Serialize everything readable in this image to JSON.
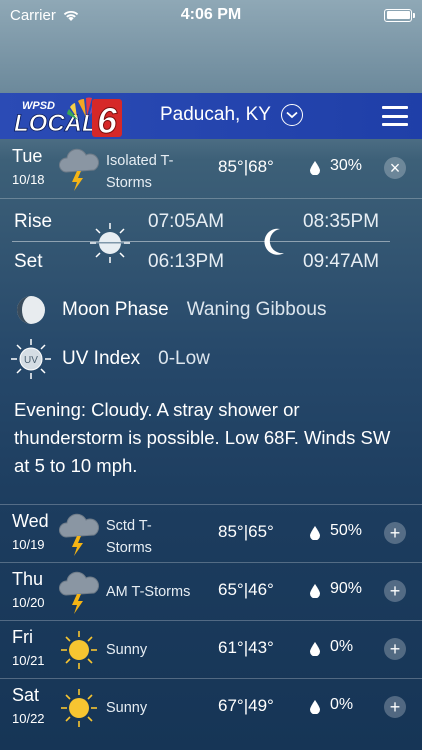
{
  "status_bar": {
    "carrier": "Carrier",
    "time": "4:06 PM"
  },
  "header": {
    "logo_top": "WPSD",
    "logo_main": "LOCAL",
    "logo_number": "6",
    "location": "Paducah, KY"
  },
  "today": {
    "day": "Tue",
    "date": "10/18",
    "condition": [
      "Isolated T-",
      "Storms"
    ],
    "temps": "85°|68°",
    "precip": "30%",
    "icon": "thunderstorm-icon",
    "action": "×"
  },
  "details": {
    "rise_label": "Rise",
    "set_label": "Set",
    "sun_rise": "07:05AM",
    "sun_set": "06:13PM",
    "moon_rise": "08:35PM",
    "moon_set": "09:47AM",
    "moon_phase_label": "Moon Phase",
    "moon_phase_value": "Waning Gibbous",
    "uv_label": "UV Index",
    "uv_value": "0-Low",
    "uv_badge": "UV",
    "forecast": "Evening: Cloudy. A stray shower or thunderstorm is possible. Low 68F. Winds SW at 5 to 10 mph."
  },
  "days": [
    {
      "day": "Wed",
      "date": "10/19",
      "condition": [
        "Sctd T-",
        "Storms"
      ],
      "temps": "85°|65°",
      "precip": "50%",
      "icon": "thunderstorm-icon",
      "action": "+"
    },
    {
      "day": "Thu",
      "date": "10/20",
      "condition": [
        "AM T-Storms"
      ],
      "temps": "65°|46°",
      "precip": "90%",
      "icon": "thunderstorm-icon",
      "action": "+"
    },
    {
      "day": "Fri",
      "date": "10/21",
      "condition": [
        "Sunny"
      ],
      "temps": "61°|43°",
      "precip": "0%",
      "icon": "sun-icon",
      "action": "+"
    },
    {
      "day": "Sat",
      "date": "10/22",
      "condition": [
        "Sunny"
      ],
      "temps": "67°|49°",
      "precip": "0%",
      "icon": "sun-icon",
      "action": "+"
    }
  ],
  "colors": {
    "header_blue": "#2346b0",
    "sun_yellow": "#f7c531",
    "bolt_yellow": "#f5b414"
  }
}
